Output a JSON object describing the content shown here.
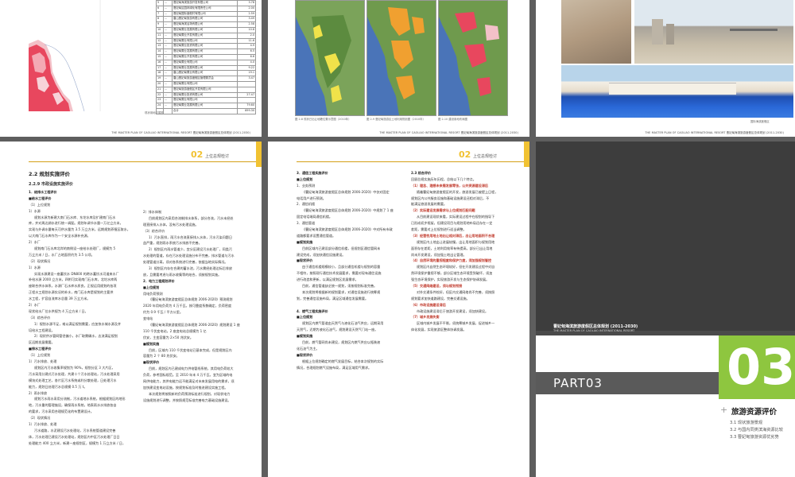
{
  "colors": {
    "accent": "#f1c232",
    "part_green": "#8ec63f",
    "dark_band": "#3a3a3a",
    "red_heading": "#c0392b"
  },
  "footer_text": "THE MASTER PLAN OF CAOLIAO INTERNATIONAL RESORT   曹妃甸海滨旅游度假区总体规划 (2011-2030)",
  "page1": {
    "map_caption": "现状用地权属图",
    "table_rows": [
      [
        "5",
        "...",
        "曹妃甸海滨旅游开发有限公司",
        "3.78"
      ],
      [
        "6",
        "...",
        "曹妃甸区园林绿化有限责任公司",
        "2.00"
      ],
      [
        "7",
        "...",
        "曹妃甸国际度假村有限公司",
        "2.59"
      ],
      [
        "8",
        "...",
        "唐山曹妃甸旅游有限公司",
        "3.49"
      ],
      [
        "9",
        "...",
        "曹妃甸海滨浴场有限公司",
        "2.58"
      ],
      [
        "10",
        "...",
        "曹妃甸置业发展有限公司",
        "10.8"
      ],
      [
        "11",
        "...",
        "曹妃甸置业开发有限公司",
        "2.0"
      ],
      [
        "12",
        "...",
        "曹妃甸置业有限公司",
        "11.6"
      ],
      [
        "13",
        "...",
        "曹妃甸置业投资有限公司",
        "4.9"
      ],
      [
        "14",
        "...",
        "曹妃甸置业发展有限公司",
        "6.5"
      ],
      [
        "15",
        "...",
        "曹妃甸置业开发有限公司",
        "6.6"
      ],
      [
        "16",
        "...",
        "曹妃甸置业有限公司",
        "4.0"
      ],
      [
        "17",
        "...",
        "曹妃甸置业发展有限公司",
        "9.22"
      ],
      [
        "18",
        "...",
        "唐山曹妃甸置业有限公司",
        "19.1"
      ],
      [
        "19",
        "...",
        "唐山曹妃甸旅游度假区管理委员会",
        "3.47"
      ],
      [
        "20",
        "...",
        "曹妃甸置业有限公司",
        ""
      ],
      [
        "21",
        "...",
        "曹妃甸旅游度假区开发有限公司",
        ""
      ],
      [
        "22",
        "...",
        "曹妃甸置业投资有限公司",
        "27.47"
      ],
      [
        "23",
        "...",
        "曹妃甸置业有限公司",
        ""
      ],
      [
        "24",
        "...",
        "曹妃甸置业发展有限公司",
        "79.60"
      ],
      [
        "",
        "",
        "合计",
        "699.30"
      ]
    ]
  },
  "page2": {
    "captions": [
      "图 2-8  现状已出让地籍位置示意图（2010年）",
      "图 2-9  曹妃甸旅游区土地利用规划图（2010年）",
      "图 2-10  建设用地布局图"
    ]
  },
  "page3": {
    "photo_caption": "国际海滨度假区"
  },
  "page4": {
    "num": "02",
    "header_title": "上位总规检讨",
    "sec": "2.2  规划实施评价",
    "sub": "2.2.9  市政设施实施评价",
    "col1": [
      {
        "t": "1．给排水工程评价",
        "c": "h"
      },
      {
        "t": "■给水工程评价",
        "c": "h"
      },
      {
        "t": "（1）上位规划",
        "c": ""
      },
      {
        "t": "1）水源",
        "c": ""
      },
      {
        "t": "规划水源为新建大南门石水库、东坨水库及扩建南门石水",
        "c": "ind"
      },
      {
        "t": "库，并对周边湖水进行统一调配。规划年调节水量一万亿立方米，",
        "c": ""
      },
      {
        "t": "实现与外调水量每天可供水量为 3.5 万立方米，远期规划养殖区取水，",
        "c": ""
      },
      {
        "t": "以大南门石水库作为一个安全水源补充源。",
        "c": ""
      },
      {
        "t": "2）水厂",
        "c": ""
      },
      {
        "t": "规划南门石水库北岸的南侧设一座给水处理厂，规模为 5",
        "c": "ind"
      },
      {
        "t": "万立方米 / 日，水厂占地面积约为 3.5 公顷。",
        "c": ""
      },
      {
        "t": "（2）现状情况",
        "c": ""
      },
      {
        "t": "1）水源",
        "c": ""
      },
      {
        "t": "实现水源建设一座蓄饮水 DN800 的跨水蓄饮水河道来水厂",
        "c": "ind"
      },
      {
        "t": "补给水源 2000 立方米，四附可实现南门石水库，北坨水库两",
        "c": ""
      },
      {
        "t": "座联合供水体系，水源厂石水库水质良，正规运用规划的各项",
        "c": ""
      },
      {
        "t": "正程水工规划水源实况的补水，南门石水库是规划的主要供",
        "c": ""
      },
      {
        "t": "水工程，扩容自流库水总量 39 万立方米。",
        "c": ""
      },
      {
        "t": "2）水厂",
        "c": ""
      },
      {
        "t": "现状给水厂位水供规为 4 万立方米 / 日。",
        "c": ""
      },
      {
        "t": "（3）综合评价",
        "c": ""
      },
      {
        "t": "1）规划水源不足，难以满足规划需要，应加快水城水源及并",
        "c": "ind"
      },
      {
        "t": "培给水工程建设。",
        "c": ""
      },
      {
        "t": "2）现状供水管网管径偏小，水厂取需确水，志流满足规划",
        "c": "ind"
      },
      {
        "t": "区远期发展需要。",
        "c": ""
      },
      {
        "t": "■排水工程评价",
        "c": "h"
      },
      {
        "t": "（1）上位规划",
        "c": ""
      },
      {
        "t": "1）污水排放、处理",
        "c": ""
      },
      {
        "t": "规划区内污水收集率规划为 90%，规划分区 3 大片区，",
        "c": "ind"
      },
      {
        "t": "污水采用分建式污水处理，共建十个污水处理站，污水处理采用",
        "c": ""
      },
      {
        "t": "模块式处理工艺，各片区污水系统或利分散处理，日处理污水",
        "c": ""
      },
      {
        "t": "能力，规划日处理污水总规模 0.5 万 t。",
        "c": ""
      },
      {
        "t": "2）雨水排放",
        "c": ""
      },
      {
        "t": "规划污水雨水采用分流制，污水道地水系统，根据规划区的地形",
        "c": "ind"
      },
      {
        "t": "地，污水重的管理施设，确保雨水系统，地表雨水水排放各自",
        "c": ""
      },
      {
        "t": "的要求，污水采用合理规范化的布置建设计。",
        "c": ""
      },
      {
        "t": "（2）现状情况",
        "c": ""
      },
      {
        "t": "1）污水排放、处理",
        "c": ""
      },
      {
        "t": "污水道路，水泥建设污水处理站，污水系统管道建设完善",
        "c": "ind"
      },
      {
        "t": "体，污水处理已建设污水处理站，规划区内中区污水处理厂日日",
        "c": ""
      },
      {
        "t": "处理能力 400 立方米，新建一座规划区，规模为 1 万立方米 / 日，",
        "c": ""
      }
    ],
    "col2": [
      {
        "t": "2）排水体制",
        "c": ""
      },
      {
        "t": "目前规划区内采用合流制排水体系，部分合流，污水未经处",
        "c": "ind"
      },
      {
        "t": "理直接排入水体，没有污水处理设施。",
        "c": ""
      },
      {
        "t": "（3）综合评价",
        "c": ""
      },
      {
        "t": "1）污水直排，雨污水合流直接排入水体，污水污染问题日",
        "c": "ind"
      },
      {
        "t": "益严重，规划雨水系统污水排放不完善。",
        "c": ""
      },
      {
        "t": "2）规划区内雨水管道少，宜分区建设污水处理厂，同类污",
        "c": "ind"
      },
      {
        "t": "水处理的管道，存在污水处理设施分布不完善，排水管道与污水",
        "c": ""
      },
      {
        "t": "处理管道分离，须对各系统进行完善，依据当地实际情况。",
        "c": ""
      },
      {
        "t": "3）规划区内存在合建的蓄水池，污水需经处理达标后排放",
        "c": "ind"
      },
      {
        "t": "放，且需要考虑与雨水收集等的结合，须按规划实施。",
        "c": ""
      },
      {
        "t": "2．电力工程规划评价",
        "c": "h"
      },
      {
        "t": "■上位规划",
        "c": "h"
      },
      {
        "t": "用电负荷预测",
        "c": ""
      },
      {
        "t": "《曹妃甸海滨旅游度假区总体规划 2006-2020》预测规划",
        "c": "ind"
      },
      {
        "t": "2020 年用电负荷为 4 万千瓦，按可靠度系数确定，负荷密度",
        "c": ""
      },
      {
        "t": "约为 0.9 千瓦 / 平方公里。",
        "c": ""
      },
      {
        "t": "变电站",
        "c": ""
      },
      {
        "t": "《曹妃甸海滨旅游度假区总体规划 2006-2020》规划建设 1 座",
        "c": "ind"
      },
      {
        "t": "110 千伏变电站，2 座变电站总规模为 1 亿",
        "c": ""
      },
      {
        "t": "伏安，主变容量为 2×50 兆伏安。",
        "c": ""
      },
      {
        "t": "■规划实施",
        "c": "h"
      },
      {
        "t": "目前，区域内 110 千伏变电站已基本完成，但是规划区内",
        "c": "ind"
      },
      {
        "t": "容量为 2 个 80 兆伏安。",
        "c": ""
      },
      {
        "t": "■现状评价",
        "c": "h"
      },
      {
        "t": "目前，规划区内已建成电力供电管线系统，其用电负荷较大",
        "c": "ind"
      },
      {
        "t": "负荷，参考国标规范。至 2010 年末 4 万千瓦，宜为区域的电",
        "c": ""
      },
      {
        "t": "网供电能力，其供电能力远不能满足对未来发展用电的需求，须",
        "c": ""
      },
      {
        "t": "加快建设变电站设施，按规划标准及时推进建设实施工程。",
        "c": ""
      },
      {
        "t": "本次规划将按照新的负荷预测标准进行规划，对现状电力",
        "c": "ind"
      },
      {
        "t": "设施规划进行调整，并按照规范标准完善电力基础设施建设。",
        "c": ""
      }
    ]
  },
  "page5": {
    "num": "02",
    "header_title": "上位总规检讨",
    "col1": [
      {
        "t": "3．通信工程实施评价",
        "c": "h"
      },
      {
        "t": "■上位规划",
        "c": "h"
      },
      {
        "t": "1．业务预测",
        "c": ""
      },
      {
        "t": "《曹妃甸海滨旅游度假区总体规划 2006-2020》中仅对固定",
        "c": "ind"
      },
      {
        "t": "电话用户进行预测。",
        "c": ""
      },
      {
        "t": "2．通信机楼",
        "c": ""
      },
      {
        "t": "《曹妃甸海滨旅游度假区总体规划 2006-2020》中规划了 1 座",
        "c": "ind"
      },
      {
        "t": "固定电话端局通信机楼。",
        "c": ""
      },
      {
        "t": "3．通信管道",
        "c": ""
      },
      {
        "t": "《曹妃甸海滨旅游度假区总体规划 2006-2020》中对所有市政",
        "c": "ind"
      },
      {
        "t": "道路都要求设置通信管道。",
        "c": ""
      },
      {
        "t": "■规划实施",
        "c": "h"
      },
      {
        "t": "目前区域内已建设部分通信机楼，但规划区通信管网未",
        "c": "ind"
      },
      {
        "t": "建设完成，须加快通信设施建设。",
        "c": ""
      },
      {
        "t": "■现状评价",
        "c": "h"
      },
      {
        "t": "由于通信机楼规模较小，且部分通信机楼与规划的容量",
        "c": "ind"
      },
      {
        "t": "不相符，按照现行通信技术发展要求，需要对现有通信设施",
        "c": ""
      },
      {
        "t": "进行改造和更新，以满足规划区发展需求。",
        "c": ""
      },
      {
        "t": "目前，通信管道缺乏统一规划，须按规划标准完善。",
        "c": "ind"
      },
      {
        "t": "本次规划将根据新的规划要求，对通信设施进行统筹规",
        "c": "ind"
      },
      {
        "t": "划，完善通信设施布局，满足区域通信发展需要。",
        "c": ""
      },
      {
        "t": "",
        "c": ""
      },
      {
        "t": "4．燃气工程实施评价",
        "c": "h"
      },
      {
        "t": "■上位规划",
        "c": "h"
      },
      {
        "t": "规划区内燃气管道由天然气与液化石油气供应，远期采用",
        "c": "ind"
      },
      {
        "t": "天然气，近期为液化石油气，规划建设天然气门站一座。",
        "c": ""
      },
      {
        "t": "■规划实施",
        "c": "h"
      },
      {
        "t": "目前，燃气管网尚未建设，规划区内燃气供应以瓶装液",
        "c": "ind"
      },
      {
        "t": "化石油气为主。",
        "c": ""
      },
      {
        "t": "■现状评价",
        "c": "h"
      },
      {
        "t": "根据上位规划确定的燃气发展目标，结合本次规划的实际",
        "c": "ind"
      },
      {
        "t": "情况，合理规划燃气设施布局，满足区域用气需求。",
        "c": ""
      }
    ],
    "col2": [
      {
        "t": "2.3  综合评价",
        "c": "h"
      },
      {
        "t": "回顾总规实施历年历程，总结以下几个特点。",
        "c": ""
      },
      {
        "t": "（1）理念、理想未来需发展零张，公共资源建设滞后",
        "c": "r"
      },
      {
        "t": "随着曹妃甸旅游度假区的开发，旅游发展已被提上日程，",
        "c": "ind"
      },
      {
        "t": "规划区内公共服务设施和基础设施建设还相对滞后，不",
        "c": ""
      },
      {
        "t": "能满足旅游发展的需要。",
        "c": ""
      },
      {
        "t": "（2）实际建设发展需求与上位规划匹配问题",
        "c": "r"
      },
      {
        "t": "从目前建设现状来看，实际建设过程中在规划的指导下",
        "c": "ind"
      },
      {
        "t": "已形成初步框架，但建设项目与规划用地布局还存在一定",
        "c": ""
      },
      {
        "t": "差距，需要对上位规划进行适当调整。",
        "c": ""
      },
      {
        "t": "（3）经营性用地土地出让相对滞后，出让用地面积不合理",
        "c": "r"
      },
      {
        "t": "规划区内土地出让进展较慢，出让用地面积与规划用地",
        "c": "ind"
      },
      {
        "t": "面积存在差距，土地利用效率有待提高，部分已出让用地",
        "c": ""
      },
      {
        "t": "尚未开发建设，须加强土地出让管理。",
        "c": ""
      },
      {
        "t": "（4）自然环境的重视程度和保护力度，须加强规划管控",
        "c": "r"
      },
      {
        "t": "规划区内自然生态环境较好，但在开发建设过程中对自",
        "c": "ind"
      },
      {
        "t": "然环境保护重视不够，部分区域生态环境受到破坏，须加",
        "c": ""
      },
      {
        "t": "强生态环境保护，实现旅游开发与生态保护协调发展。",
        "c": ""
      },
      {
        "t": "（5）交通网络建设，须与规划衔接",
        "c": "r"
      },
      {
        "t": "对外交通条件较好，但区内交通网络尚不完善，须按照",
        "c": "ind"
      },
      {
        "t": "规划要求加快道路建设，完善交通设施。",
        "c": ""
      },
      {
        "t": "（6）市政设施建设滞后",
        "c": "r"
      },
      {
        "t": "市政设施建设滞后于旅游开发建设，须加快建设。",
        "c": "ind"
      },
      {
        "t": "（7）城乡发展失衡",
        "c": "r"
      },
      {
        "t": "区域内城乡发展不平衡，须统筹城乡发展，促进城乡一",
        "c": "ind"
      },
      {
        "t": "体化发展，实现旅游区整体协调发展。",
        "c": ""
      }
    ]
  },
  "page6": {
    "small_title": "曹妃甸海滨旅游度假区总体规划 (2011-2030)",
    "small_sub": "THE MASTER PLAN OF CAOLIAO INTERNATIONAL RESORT",
    "part": "PART03",
    "big_num": "03",
    "chapter_title": "旅游资源评价",
    "toc": [
      "3.1 现状旅游景观",
      "3.2 与国内同类滨海资源比较",
      "3.3 曹妃甸旅游资源优劣势"
    ]
  }
}
